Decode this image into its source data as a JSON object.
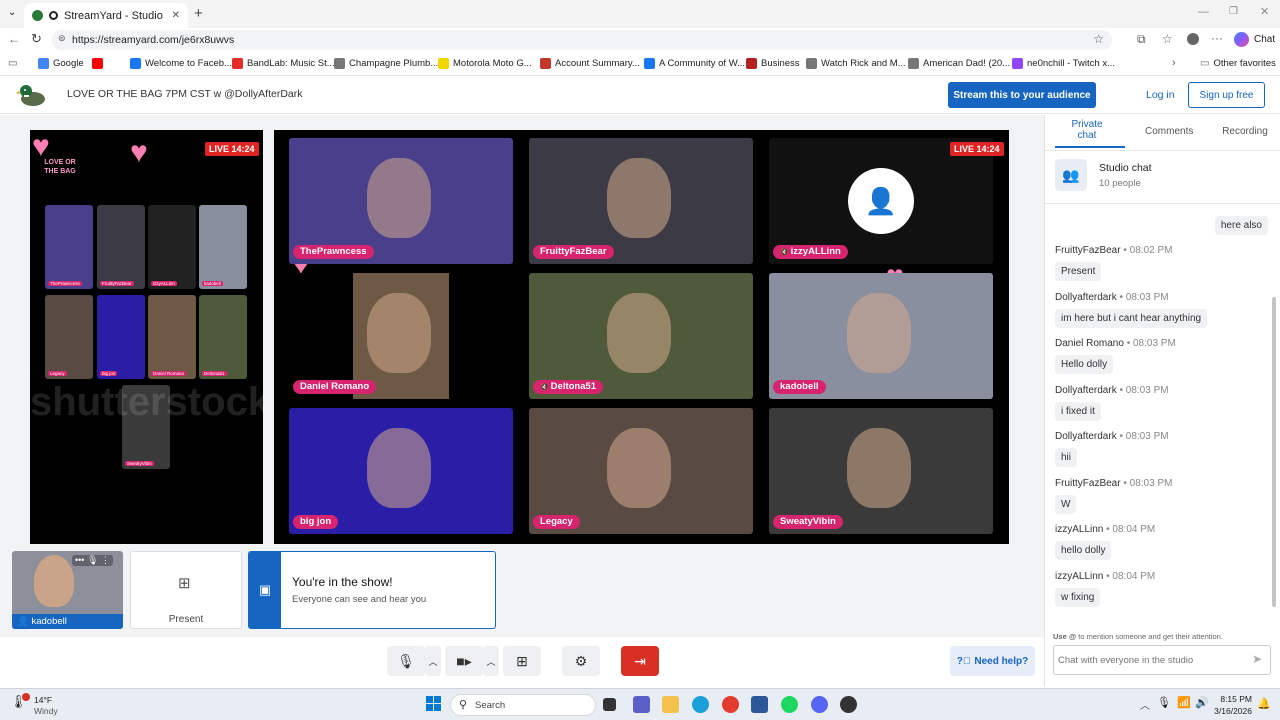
{
  "browser": {
    "tab_title": "StreamYard - Studio",
    "new_tab_symbol": "+",
    "tab_close_symbol": "✕",
    "url": "https://streamyard.com/je6rx8uwvs",
    "chat_label": "Chat",
    "favorites": [
      {
        "label": "Google",
        "color": "#4285f4"
      },
      {
        "label": "",
        "color": "#ff0000"
      },
      {
        "label": "Welcome to Faceb...",
        "color": "#1877f2"
      },
      {
        "label": "BandLab: Music St...",
        "color": "#e52d27"
      },
      {
        "label": "Champagne Plumb...",
        "color": "#777777"
      },
      {
        "label": "Motorola Moto G...",
        "color": "#f2d600"
      },
      {
        "label": "Account Summary...",
        "color": "#c0392b"
      },
      {
        "label": "A Community of W...",
        "color": "#1877f2"
      },
      {
        "label": "Business",
        "color": "#b22222"
      },
      {
        "label": "Watch Rick and M...",
        "color": "#777777"
      },
      {
        "label": "American Dad! (20...",
        "color": "#777777"
      },
      {
        "label": "ne0nchill - Twitch x...",
        "color": "#9146ff"
      }
    ],
    "other_favorites": "Other favorites"
  },
  "header": {
    "title": "LOVE OR THE BAG 7PM CST w @DollyAfterDark",
    "stream_button": "Stream this to your audience",
    "login": "Log in",
    "signup": "Sign up free"
  },
  "preview": {
    "live_label": "LIVE 14:24",
    "logo_text": "LOVE OR THE BAG",
    "watermark": "shutterstock",
    "mini_tags": [
      "ThePrawncess",
      "FruittyFazBear",
      "izzyALLinn",
      "kadobell",
      "Legacy",
      "big jon",
      "Daniel Romano",
      "Deltona51",
      "SweatyVibin"
    ]
  },
  "grid": {
    "live_label": "LIVE 14:24",
    "participants": [
      {
        "name": "ThePrawncess",
        "muted": false,
        "color": "#4a3f8a"
      },
      {
        "name": "FruittyFazBear",
        "muted": false,
        "color": "#3c3a44"
      },
      {
        "name": "izzyALLinn",
        "muted": true,
        "color": "#111111"
      },
      {
        "name": "Daniel Romano",
        "muted": false,
        "color": "#6e5a44"
      },
      {
        "name": "Deltona51",
        "muted": true,
        "color": "#4e5a3a"
      },
      {
        "name": "kadobell",
        "muted": false,
        "color": "#8a8fa0"
      },
      {
        "name": "big jon",
        "muted": false,
        "color": "#2a1ea6"
      },
      {
        "name": "Legacy",
        "muted": false,
        "color": "#5a4a44"
      },
      {
        "name": "SweatyVibin",
        "muted": false,
        "color": "#3a3a3a"
      }
    ]
  },
  "bottom": {
    "self_name": "kadobell",
    "present_label": "Present",
    "show_title": "You're in the show!",
    "show_sub": "Everyone can see and hear you",
    "need_help": "Need help?"
  },
  "panel": {
    "tabs": [
      "Private chat",
      "Comments",
      "Recording"
    ],
    "studio_chat": "Studio chat",
    "people": "10 people",
    "first_bubble": "here also",
    "messages": [
      {
        "author": "FruittyFazBear",
        "time": "08:02 PM",
        "text": "Present"
      },
      {
        "author": "Dollyafterdark",
        "time": "08:03 PM",
        "text": "im here but i cant hear anything"
      },
      {
        "author": "Daniel Romano",
        "time": "08:03 PM",
        "text": "Hello dolly"
      },
      {
        "author": "Dollyafterdark",
        "time": "08:03 PM",
        "text": "i fixed it"
      },
      {
        "author": "Dollyafterdark",
        "time": "08:03 PM",
        "text": "hii"
      },
      {
        "author": "FruittyFazBear",
        "time": "08:03 PM",
        "text": "W"
      },
      {
        "author": "izzyALLinn",
        "time": "08:04 PM",
        "text": "hello dolly"
      },
      {
        "author": "izzyALLinn",
        "time": "08:04 PM",
        "text": "w fixing"
      }
    ],
    "mention_hint": "Use @ to mention someone and get their attention.",
    "mention_bold": "Use @",
    "mention_rest": " to mention someone and get their attention.",
    "input_placeholder": "Chat with everyone in the studio"
  },
  "taskbar": {
    "weather_temp": "14°F",
    "weather_desc": "Windy",
    "search": "Search",
    "time": "8:15 PM",
    "date": "3/16/2026"
  }
}
